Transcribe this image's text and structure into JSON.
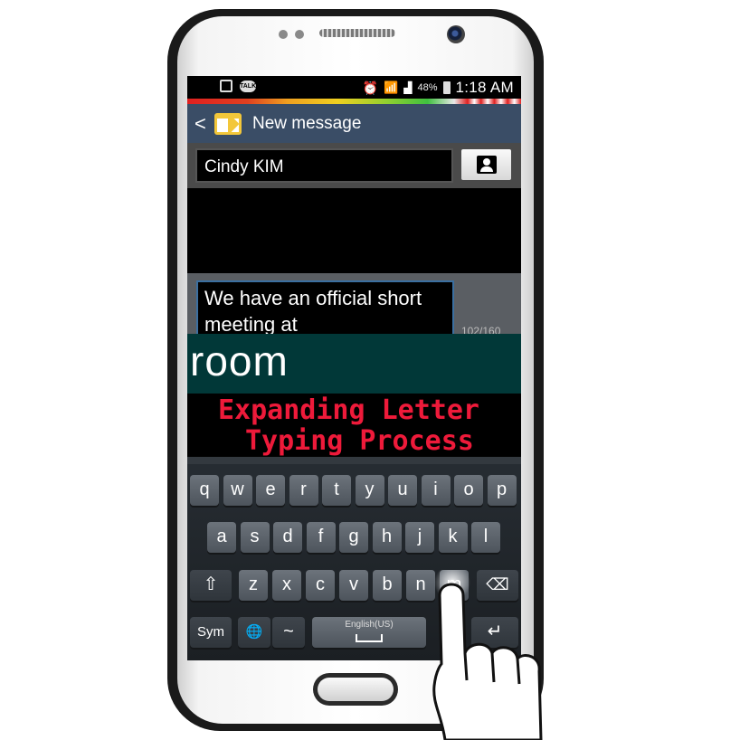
{
  "status_bar": {
    "battery_percent": "48%",
    "time": "1:18 AM",
    "notification_icons": [
      "image-icon",
      "talk-icon"
    ],
    "status_icons": [
      "alarm-icon",
      "wifi-icon",
      "signal-icon",
      "battery-icon"
    ],
    "talk_label": "TALK"
  },
  "action_bar": {
    "back": "<",
    "title": "New message"
  },
  "recipient": {
    "value": "Cindy KIM"
  },
  "composer": {
    "message": "We have an official short meeting at",
    "counter": "102/160"
  },
  "suggestion": {
    "word": "room"
  },
  "overlay": {
    "line1": "Expanding Letter",
    "line2": "Typing Process"
  },
  "keyboard": {
    "row1": [
      "q",
      "w",
      "e",
      "r",
      "t",
      "y",
      "u",
      "i",
      "o",
      "p"
    ],
    "row2": [
      "a",
      "s",
      "d",
      "f",
      "g",
      "h",
      "j",
      "k",
      "l"
    ],
    "row3": [
      "z",
      "x",
      "c",
      "v",
      "b",
      "n",
      "m"
    ],
    "shift": "⇧",
    "backspace": "⌫",
    "sym": "Sym",
    "globe": "🌐",
    "tilde": "~",
    "space_label": "English(US)",
    "enter": "↵"
  }
}
